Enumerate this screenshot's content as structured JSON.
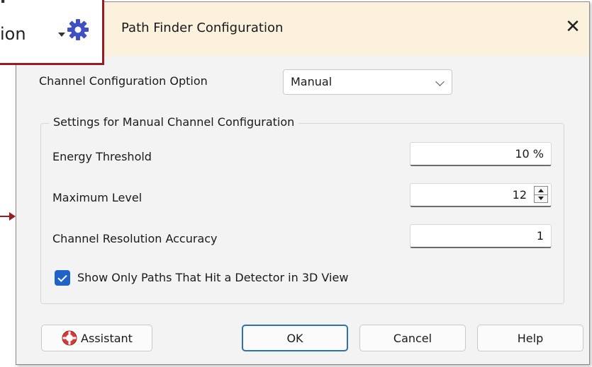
{
  "dialog": {
    "title": "Path Finder Configuration",
    "close_glyph": "✕"
  },
  "config": {
    "option_label": "Channel Configuration Option",
    "option_value": "Manual",
    "group_title": "Settings for Manual Channel Configuration",
    "rows": [
      {
        "label": "Energy Threshold",
        "value": "10 %"
      },
      {
        "label": "Maximum Level",
        "value": "12"
      },
      {
        "label": "Channel Resolution Accuracy",
        "value": "1"
      }
    ],
    "checkbox_label": "Show Only Paths That Hit a Detector in 3D View",
    "checkbox_checked": true
  },
  "buttons": {
    "assistant": "Assistant",
    "ok": "OK",
    "cancel": "Cancel",
    "help": "Help"
  },
  "callout": {
    "text_top": "l",
    "text": "ion",
    "accent_color": "#9a1c22"
  },
  "colors": {
    "title_bg": "#fbf1dc",
    "checkbox": "#1e64c8",
    "ok_border": "#2f6fb6",
    "gear": "#3f4fc4"
  }
}
